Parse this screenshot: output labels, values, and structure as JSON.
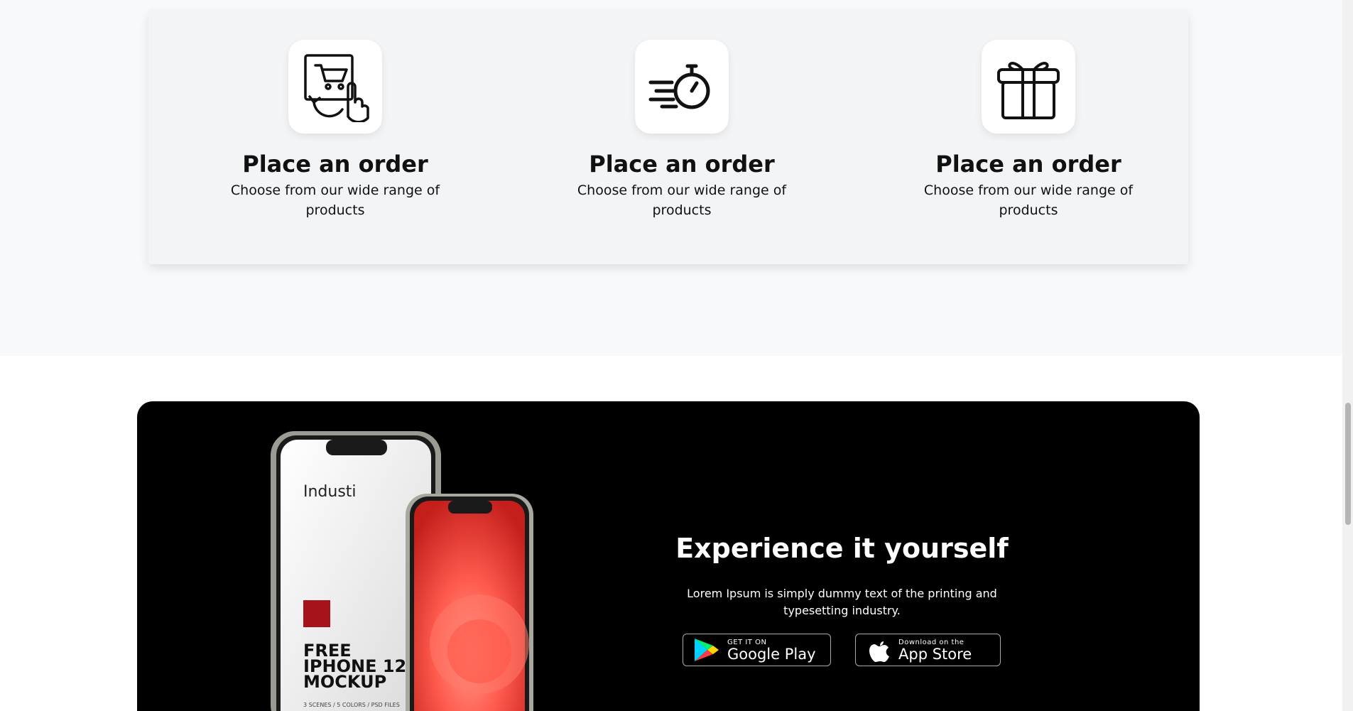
{
  "features": [
    {
      "icon": "cart-click-icon",
      "title": "Place an order",
      "description": "Choose from our wide range of products"
    },
    {
      "icon": "stopwatch-speed-icon",
      "title": "Place an order",
      "description": "Choose from our wide range of products"
    },
    {
      "icon": "gift-box-icon",
      "title": "Place an order",
      "description": "Choose from our wide range of products"
    }
  ],
  "cta": {
    "heading": "Experience it yourself",
    "subtext": "Lorem Ipsum is simply dummy text of the printing and typesetting industry."
  },
  "mockup": {
    "brand": "Industi",
    "headline_line1": "FREE",
    "headline_line2": "IPHONE 12",
    "headline_line3": "MOCKUP",
    "footnote": "3 SCENES / 5 COLORS / PSD FILES"
  },
  "badges": {
    "google_small": "GET IT ON",
    "google_big": "Google Play",
    "apple_small": "Download on the",
    "apple_big": "App Store"
  },
  "colors": {
    "section_bg": "#f8f9fb",
    "card_bg": "#f3f4f6",
    "cta_bg": "#000000",
    "phone_screen_accent": "#ef3b36"
  }
}
